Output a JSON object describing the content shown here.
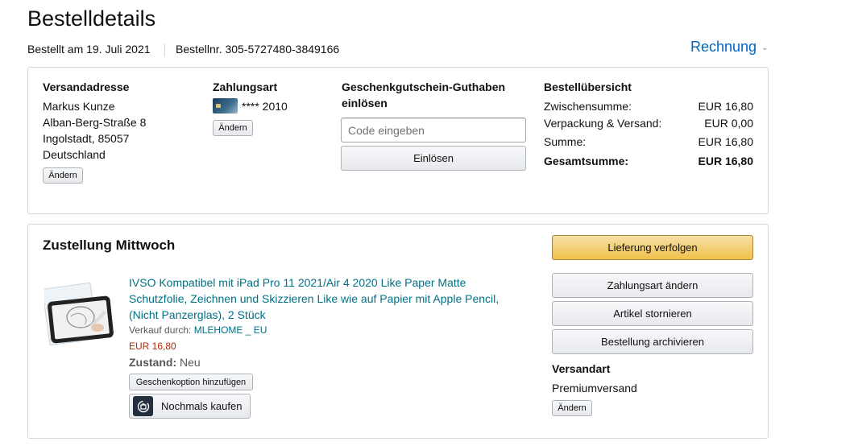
{
  "page": {
    "title": "Bestelldetails"
  },
  "order_meta": {
    "ordered": "Bestellt am 19. Juli 2021",
    "order_no": "Bestellnr. 305-5727480-3849166",
    "invoice": "Rechnung"
  },
  "shipping_address": {
    "heading": "Versandadresse",
    "lines": [
      "Markus Kunze",
      "Alban-Berg-Straße 8",
      "Ingolstadt, 85057",
      "Deutschland"
    ],
    "change": "Ändern"
  },
  "payment": {
    "heading": "Zahlungsart",
    "card": "**** 2010",
    "change": "Ändern"
  },
  "gift_card": {
    "heading_line1": "Geschenkgutschein-Guthaben",
    "heading_line2": "einlösen",
    "placeholder": "Code eingeben",
    "redeem": "Einlösen"
  },
  "summary": {
    "heading": "Bestellübersicht",
    "rows": [
      {
        "label": "Zwischensumme:",
        "value": "EUR 16,80"
      },
      {
        "label": "Verpackung & Versand:",
        "value": "EUR 0,00"
      },
      {
        "label": "Summe:",
        "value": "EUR 16,80"
      },
      {
        "label": "Gesamtsumme:",
        "value": "EUR 16,80"
      }
    ]
  },
  "delivery": {
    "heading": "Zustellung Mittwoch",
    "item": {
      "title_line1": "IVSO Kompatibel mit iPad Pro 11 2021/Air 4 2020 Like Paper Matte",
      "title_line2": "Schutzfolie, Zeichnen und Skizzieren Like wie auf Papier mit Apple Pencil,",
      "title_line3": "(Nicht Panzerglas), 2 Stück",
      "seller_label": "Verkauf durch:",
      "seller": "MLEHOME _ EU",
      "price": "EUR 16,80",
      "condition_label": "Zustand:",
      "condition": "Neu",
      "gift_option": "Geschenkoption hinzufügen",
      "buy_again": "Nochmals kaufen"
    },
    "actions": {
      "track": "Lieferung verfolgen",
      "change_payment": "Zahlungsart ändern",
      "cancel": "Artikel stornieren",
      "archive": "Bestellung archivieren"
    },
    "shipping_method": {
      "heading": "Versandart",
      "value": "Premiumversand",
      "change": "Ändern"
    }
  },
  "colors": {
    "link": "#007185",
    "invoice_link": "#0066c0",
    "price": "#b12704",
    "primary_button": "#f0c14b"
  }
}
